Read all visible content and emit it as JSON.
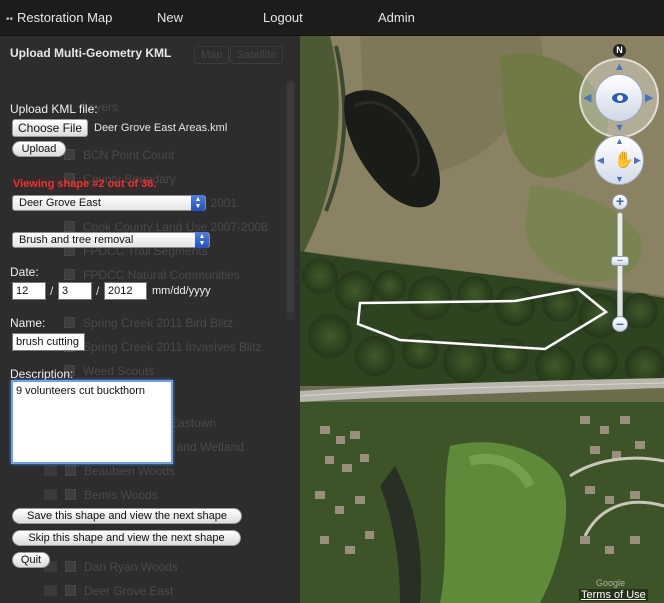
{
  "topbar": {
    "brand": "Restoration Map",
    "nav": [
      "New",
      "Logout",
      "Admin"
    ]
  },
  "panel": {
    "title": "Upload Multi-Geometry KML",
    "upload_label": "Upload KML file:",
    "choose_file_label": "Choose File",
    "file_name": "Deer Grove East Areas.kml",
    "upload_button": "Upload",
    "viewing_status": "Viewing shape #2 out of 36.",
    "site_select": "Deer Grove East",
    "activity_select": "Brush and tree removal",
    "date_label": "Date:",
    "date_month": "12",
    "date_day": "3",
    "date_year": "2012",
    "date_sep": "/",
    "date_format": "mm/dd/yyyy",
    "name_label": "Name:",
    "name_value": "brush cutting",
    "description_label": "Description:",
    "description_value": "9 volunteers cut buckthorn",
    "save_next_button": "Save this shape and view the next shape",
    "skip_next_button": "Skip this shape and view the next shape",
    "quit_button": "Quit"
  },
  "background_layers": [
    "Layers",
    "BCN Point Count",
    "County Boundary",
    "Cook County Land Use 2001",
    "Cook County Land Use 2007-2008",
    "FPDCC Trail Segments",
    "FPDCC Natural Communities",
    "Spring Creek 2011 Bird Blitz",
    "Spring Creek 2011 Invasives Blitz",
    "Weed Scouts",
    "Arie Crown and Eastown",
    "Bartel Grassland and Wetland",
    "Beaubien Woods",
    "Bemis Woods",
    "Dan Ryan Woods",
    "Deer Grove East"
  ],
  "background_tabs": [
    "Map",
    "Satellite"
  ],
  "map": {
    "compass_label": "N",
    "terms": "Terms of Use",
    "attribution": "Google"
  },
  "colors": {
    "topbar": "#1c1c1c",
    "panel": "#2d2d2d",
    "warning": "#ff2a2a",
    "select_arrow": "#2a5fd0",
    "polygon_outline": "#ffffff"
  }
}
